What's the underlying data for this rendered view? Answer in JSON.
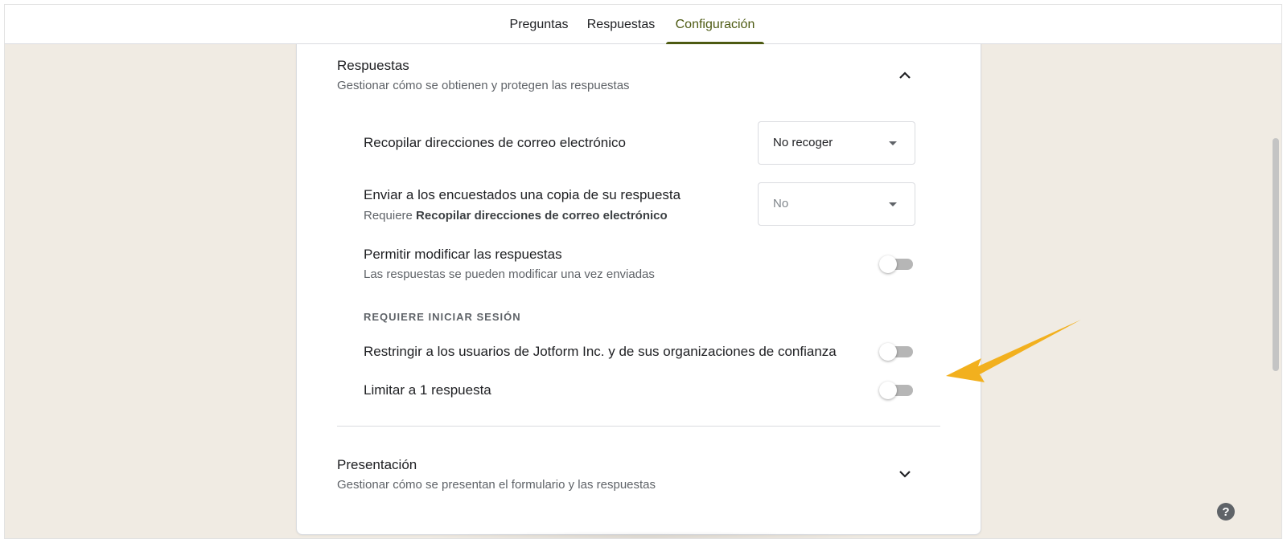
{
  "tabs": [
    {
      "label": "Preguntas"
    },
    {
      "label": "Respuestas"
    },
    {
      "label": "Configuración",
      "active": true
    }
  ],
  "responses_section": {
    "title": "Respuestas",
    "subtitle": "Gestionar cómo se obtienen y protegen las respuestas",
    "collapse_icon": "chevron-up-icon",
    "collect_emails": {
      "label": "Recopilar direcciones de correo electrónico",
      "value": "No recoger"
    },
    "send_copy": {
      "label": "Enviar a los encuestados una copia de su respuesta",
      "sub_prefix": "Requiere ",
      "sub_bold": "Recopilar direcciones de correo electrónico",
      "value": "No"
    },
    "allow_edit": {
      "label": "Permitir modificar las respuestas",
      "sub": "Las respuestas se pueden modificar una vez enviadas",
      "on": false
    },
    "login_group_heading": "REQUIERE INICIAR SESIÓN",
    "restrict_users": {
      "label": "Restringir a los usuarios de Jotform Inc. y de sus organizaciones de confianza",
      "on": false
    },
    "limit_one": {
      "label": "Limitar a 1 respuesta",
      "on": false
    }
  },
  "presentation_section": {
    "title": "Presentación",
    "subtitle": "Gestionar cómo se presentan el formulario y las respuestas",
    "expand_icon": "chevron-down-icon"
  },
  "help_label": "?",
  "colors": {
    "accent": "#4d5a12",
    "arrow": "#f2b01e",
    "background": "#f0ebe3"
  }
}
